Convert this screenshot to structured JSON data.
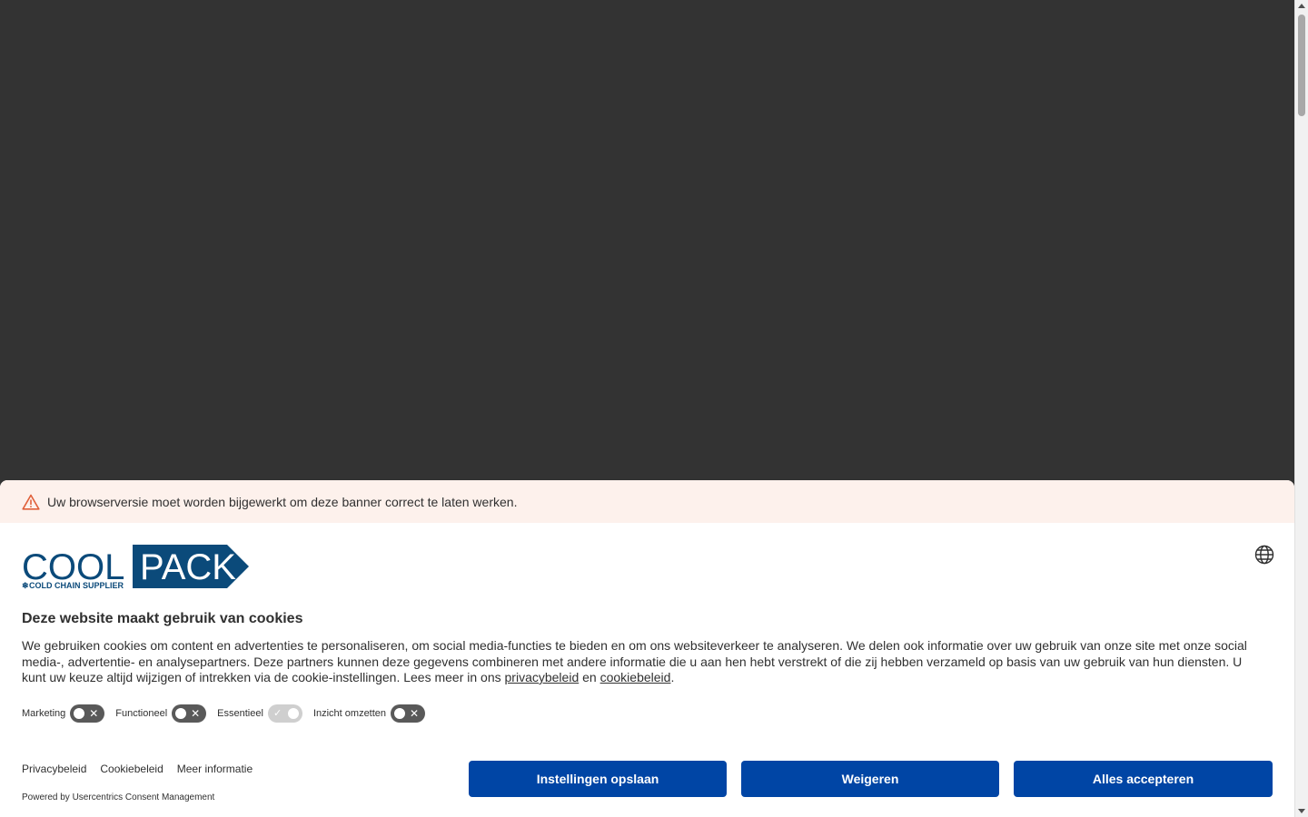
{
  "warning": {
    "text": "Uw browserversie moet worden bijgewerkt om deze banner correct te laten werken."
  },
  "logo": {
    "brand_left": "COOL",
    "brand_right": "PACK",
    "tagline": "COLD CHAIN SUPPLIER",
    "color_primary": "#0b4a7a"
  },
  "consent": {
    "title": "Deze website maakt gebruik van cookies",
    "description": "We gebruiken cookies om content en advertenties te personaliseren, om social media-functies te bieden en om ons websiteverkeer te analyseren. We delen ook informatie over uw gebruik van onze site met onze social media-, advertentie- en analysepartners. Deze partners kunnen deze gegevens combineren met andere informatie die u aan hen hebt verstrekt of die zij hebben verzameld op basis van uw gebruik van hun diensten. U kunt uw keuze altijd wijzigen of intrekken via de cookie-instellingen. Lees meer in ons ",
    "privacy_link": "privacybeleid",
    "and_word": " en ",
    "cookie_link": "cookiebeleid",
    "period": "."
  },
  "toggles": {
    "marketing": "Marketing",
    "functioneel": "Functioneel",
    "essentieel": "Essentieel",
    "inzicht": "Inzicht omzetten"
  },
  "footer": {
    "privacy": "Privacybeleid",
    "cookie": "Cookiebeleid",
    "more": "Meer informatie",
    "powered": "Powered by Usercentrics Consent Management"
  },
  "buttons": {
    "save": "Instellingen opslaan",
    "deny": "Weigeren",
    "accept": "Alles accepteren"
  },
  "colors": {
    "accent": "#0045a5",
    "warning_bg": "#fdf1ec",
    "overlay": "#333333"
  }
}
